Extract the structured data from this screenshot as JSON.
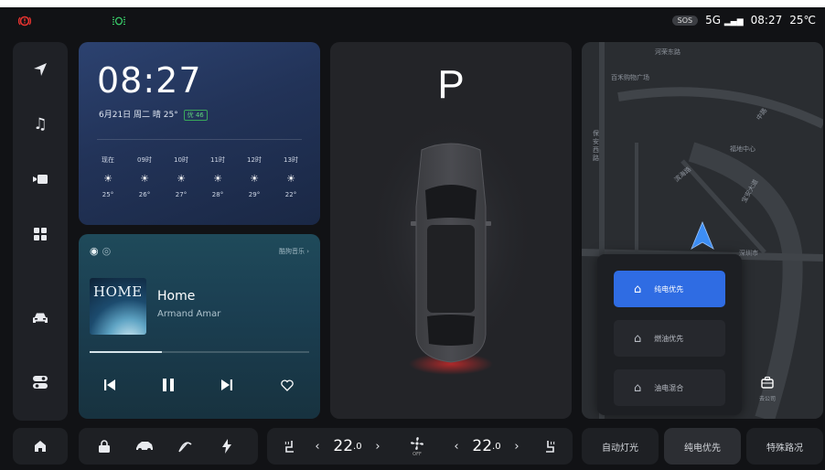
{
  "status_bar": {
    "left_icon": "tire-pressure-warning-icon",
    "green_icon": "dim-light-indicator-icon",
    "sos_label": "SOS",
    "network": "5G",
    "time": "08:27",
    "temperature": "25℃"
  },
  "sidebar": [
    {
      "name": "navigation",
      "icon": "➤"
    },
    {
      "name": "music",
      "icon": "♫"
    },
    {
      "name": "media",
      "icon": "▶"
    },
    {
      "name": "apps",
      "icon": "▦"
    },
    {
      "name": "car",
      "icon": "⛍"
    },
    {
      "name": "settings",
      "icon": "⚌"
    }
  ],
  "weather": {
    "time": "08:27",
    "date": "6月21日 周二",
    "condition": "晴 25°",
    "aqi": "优 46",
    "forecast": [
      {
        "label": "现在",
        "temp": "25°"
      },
      {
        "label": "09时",
        "temp": "26°"
      },
      {
        "label": "10时",
        "temp": "27°"
      },
      {
        "label": "11时",
        "temp": "28°"
      },
      {
        "label": "12时",
        "temp": "29°"
      },
      {
        "label": "13时",
        "temp": "22°"
      }
    ]
  },
  "music": {
    "source_icons": "◉ ◎",
    "more": "酷狗音乐 ›",
    "album_text": "HOME",
    "title": "Home",
    "artist": "Armand Amar",
    "progress": 0.33
  },
  "vehicle": {
    "gear": "P"
  },
  "map": {
    "labels": [
      "河荣东路",
      "百禾购物广场",
      "保安西路",
      "福地中心",
      "滨海路",
      "宝安大道",
      "深圳市",
      "中路"
    ],
    "poi_label": "去公司",
    "routes": [
      {
        "label": "纯电优先",
        "active": true
      },
      {
        "label": "燃油优先",
        "active": false
      },
      {
        "label": "油电混合",
        "active": false
      }
    ]
  },
  "bottom_bar": {
    "home_icon": "home-icon",
    "quick": [
      "lock-icon",
      "car-side-icon",
      "wiper-icon",
      "charge-icon"
    ],
    "left_temp": "22",
    "left_temp_decimal": ".0",
    "right_temp": "22",
    "right_temp_decimal": ".0",
    "fan_state": "OFF",
    "buttons": [
      "自动灯光",
      "纯电优先",
      "特殊路况"
    ]
  },
  "colors": {
    "accent": "#2f6ce3",
    "nav_arrow": "#3d8ef5",
    "warning": "#e6332f",
    "brake_glow": "#d42a2a"
  }
}
